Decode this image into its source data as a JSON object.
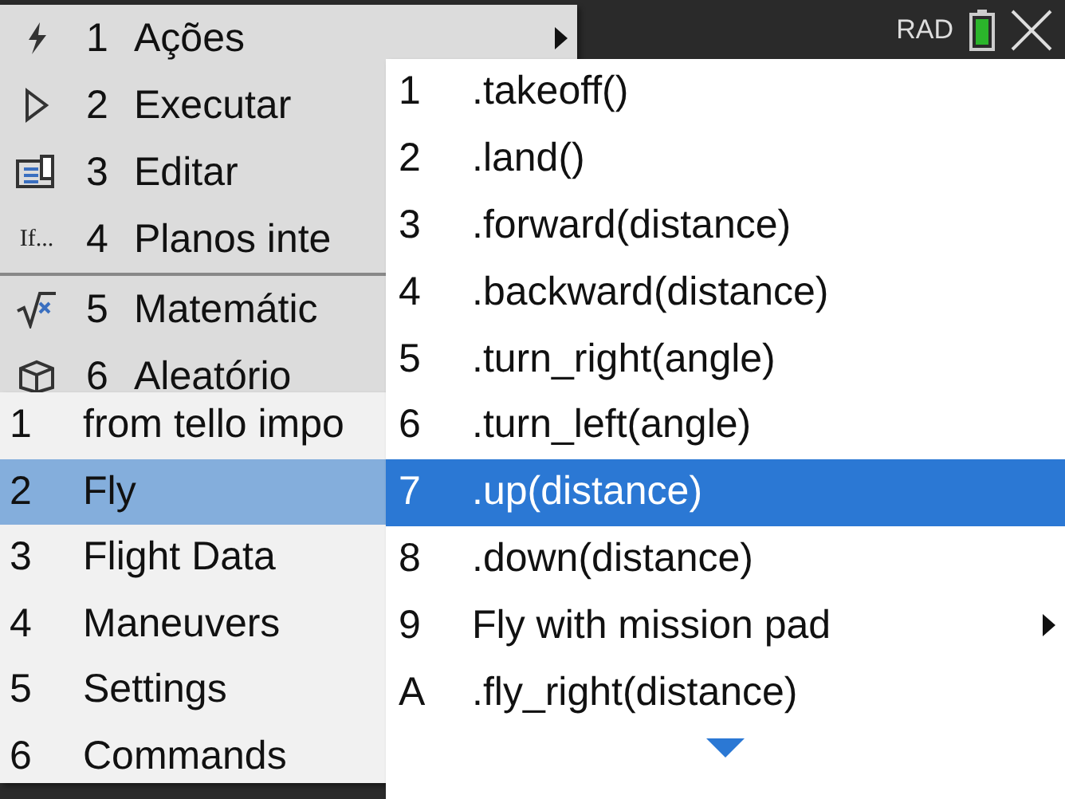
{
  "status_bar": {
    "angle_mode": "RAD",
    "battery": true
  },
  "main_menu": [
    {
      "key": "1",
      "label": "Ações",
      "kind": "bolt",
      "submenu": true,
      "selected": false
    },
    {
      "key": "2",
      "label": "Executar",
      "kind": "play",
      "submenu": false,
      "selected": false
    },
    {
      "key": "3",
      "label": "Editar",
      "kind": "edit",
      "submenu": false,
      "selected": false
    },
    {
      "key": "4",
      "label": "Planos inte",
      "kind": "if",
      "icon_text": "If...",
      "submenu": false,
      "selected": false,
      "divider_after": true
    },
    {
      "key": "5",
      "label": "Matemátic",
      "kind": "sqrt",
      "submenu": false,
      "selected": false
    },
    {
      "key": "6",
      "label": "Aleatório",
      "kind": "dice",
      "submenu": false,
      "selected": false
    }
  ],
  "module_menu": [
    {
      "key": "1",
      "label": "from tello impo",
      "selected": false
    },
    {
      "key": "2",
      "label": "Fly",
      "selected": true
    },
    {
      "key": "3",
      "label": "Flight Data",
      "selected": false
    },
    {
      "key": "4",
      "label": "Maneuvers",
      "selected": false
    },
    {
      "key": "5",
      "label": "Settings",
      "selected": false
    },
    {
      "key": "6",
      "label": "Commands",
      "selected": false
    }
  ],
  "fly_menu": [
    {
      "key": "1",
      "label": ".takeoff()",
      "submenu": false,
      "selected": false
    },
    {
      "key": "2",
      "label": ".land()",
      "submenu": false,
      "selected": false
    },
    {
      "key": "3",
      "label": ".forward(distance)",
      "submenu": false,
      "selected": false
    },
    {
      "key": "4",
      "label": ".backward(distance)",
      "submenu": false,
      "selected": false
    },
    {
      "key": "5",
      "label": ".turn_right(angle)",
      "submenu": false,
      "selected": false
    },
    {
      "key": "6",
      "label": ".turn_left(angle)",
      "submenu": false,
      "selected": false
    },
    {
      "key": "7",
      "label": ".up(distance)",
      "submenu": false,
      "selected": true
    },
    {
      "key": "8",
      "label": ".down(distance)",
      "submenu": false,
      "selected": false
    },
    {
      "key": "9",
      "label": "Fly with mission pad",
      "submenu": true,
      "selected": false
    },
    {
      "key": "A",
      "label": ".fly_right(distance)",
      "submenu": false,
      "selected": false
    }
  ],
  "more_below": true
}
